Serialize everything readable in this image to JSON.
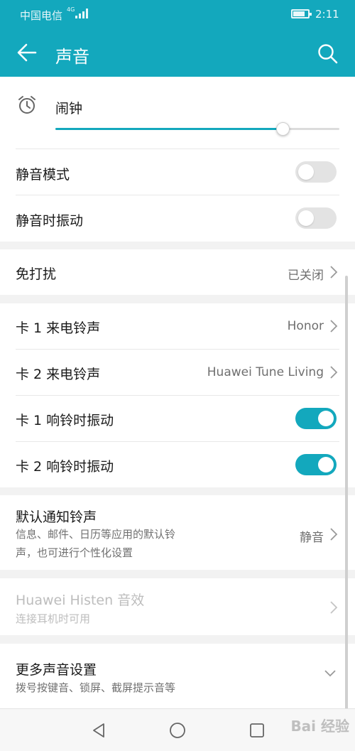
{
  "status_bar": {
    "carrier": "中国电信",
    "signal": "4G",
    "battery_level": 0.8,
    "time": "2:11"
  },
  "app_bar": {
    "title": "声音"
  },
  "alarm": {
    "label": "闹钟",
    "volume": 0.8
  },
  "silent_mode": {
    "label": "静音模式",
    "on": false
  },
  "silent_vibrate": {
    "label": "静音时振动",
    "on": false
  },
  "dnd": {
    "label": "免打扰",
    "value": "已关闭"
  },
  "ringtone1": {
    "label": "卡 1 来电铃声",
    "value": "Honor"
  },
  "ringtone2": {
    "label": "卡 2 来电铃声",
    "value": "Huawei Tune Living"
  },
  "vibrate1": {
    "label": "卡 1 响铃时振动",
    "on": true
  },
  "vibrate2": {
    "label": "卡 2 响铃时振动",
    "on": true
  },
  "notification": {
    "label": "默认通知铃声",
    "desc_line1": "信息、邮件、日历等应用的默认铃",
    "desc_line2": "声，也可进行个性化设置",
    "value": "静音"
  },
  "histen": {
    "label": "Huawei Histen 音效",
    "desc": "连接耳机时可用",
    "enabled": false
  },
  "more_sound": {
    "label": "更多声音设置",
    "desc": "拨号按键音、锁屏、截屏提示音等"
  },
  "watermark": "Bai 经验"
}
